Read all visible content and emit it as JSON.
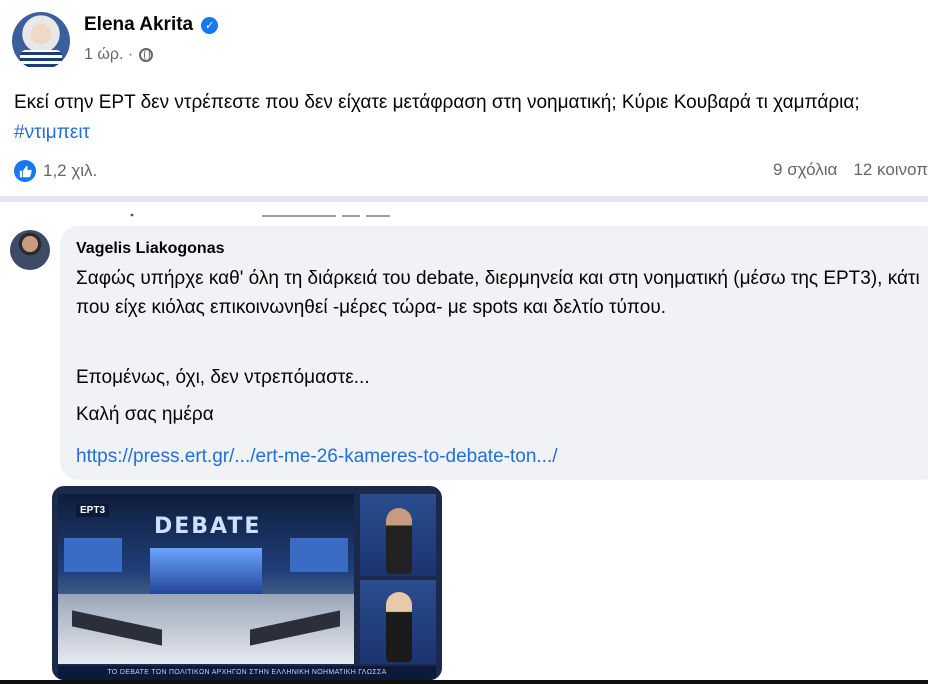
{
  "post": {
    "author": "Elena Akrita",
    "time": "1 ώρ. ·",
    "text": "Εκεί στην ΕΡΤ δεν ντρέπεστε που δεν είχατε μετάφραση στη νοηματική;  Κύριε Κουβαρά τι χαμπάρια; ",
    "hashtag": "#ντιμπειτ",
    "reactions": "1,2 χιλ.",
    "comments": "9 σχόλια",
    "shares": "12 κοινοπ"
  },
  "comment": {
    "author": "Vagelis Liakogonas",
    "text": "Σαφώς υπήρχε καθ' όλη τη διάρκειά του debate, διερμηνεία και στη νοηματική (μέσω της ΕΡΤ3), κάτι που είχε κιόλας επικοινωνηθεί -μέρες τώρα- με spots και δελτίο τύπου.",
    "line2": "Επομένως, όχι, δεν ντρεπόμαστε...",
    "line3": "Καλή σας ημέρα",
    "link": "https://press.ert.gr/.../ert-me-26-kameres-to-debate-ton.../"
  },
  "attachment": {
    "badge": "ΕΡΤ3",
    "studio_title": "DEBATE",
    "caption": "ΤΟ DEBATE ΤΩΝ ΠΟΛΙΤΙΚΩΝ ΑΡΧΗΓΩΝ ΣΤΗΝ ΕΛΛΗΝΙΚΗ ΝΟΗΜΑΤΙΚΗ ΓΛΩΣΣΑ"
  },
  "colors": {
    "link": "#216fdb",
    "like": "#1877f2",
    "bubble": "#f0f2f5"
  }
}
